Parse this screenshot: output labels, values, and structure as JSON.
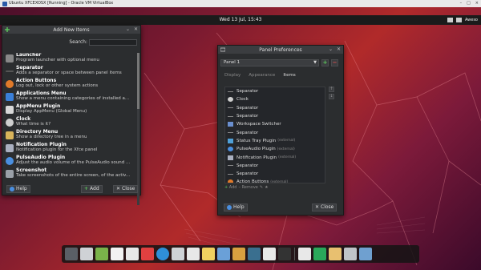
{
  "vbox": {
    "title": "Ubuntu XFCEXOSX [Running] - Oracle VM VirtualBox",
    "controls": [
      "–",
      "□",
      "×"
    ]
  },
  "panel": {
    "clock": "Wed 13 Jul, 15:43",
    "user": "Aweso"
  },
  "add_items": {
    "title": "Add New Items",
    "search_label": "Search:",
    "search_value": "",
    "items": [
      {
        "name": "Launcher",
        "desc": "Program launcher with optional menu",
        "icon": "launcher-icon"
      },
      {
        "name": "Separator",
        "desc": "Adds a separator or space between panel items",
        "icon": "separator-icon"
      },
      {
        "name": "Action Buttons",
        "desc": "Log out, lock or other system actions",
        "icon": "action-buttons-icon"
      },
      {
        "name": "Applications Menu",
        "desc": "Show a menu containing categories of installed a...",
        "icon": "applications-menu-icon"
      },
      {
        "name": "AppMenu Plugin",
        "desc": "Display AppMenu (Global Menu)",
        "icon": "appmenu-icon"
      },
      {
        "name": "Clock",
        "desc": "What time is it?",
        "icon": "clock-icon"
      },
      {
        "name": "Directory Menu",
        "desc": "Show a directory tree in a menu",
        "icon": "folder-icon"
      },
      {
        "name": "Notification Plugin",
        "desc": "Notification plugin for the Xfce panel",
        "icon": "notification-icon"
      },
      {
        "name": "PulseAudio Plugin",
        "desc": "Adjust the audio volume of the PulseAudio sound ...",
        "icon": "pulseaudio-icon"
      },
      {
        "name": "Screenshot",
        "desc": "Take screenshots of the entire screen, of the activ...",
        "icon": "screenshot-icon"
      }
    ],
    "help_label": "Help",
    "add_label": "Add",
    "close_label": "Close"
  },
  "prefs": {
    "title": "Panel Preferences",
    "panel_select": "Panel 1",
    "tabs": [
      "Display",
      "Appearance",
      "Items"
    ],
    "active_tab": "Items",
    "items": [
      {
        "name": "Separator",
        "ext": "",
        "icon": "separator-icon"
      },
      {
        "name": "Clock",
        "ext": "",
        "icon": "clock-icon"
      },
      {
        "name": "Separator",
        "ext": "",
        "icon": "separator-icon"
      },
      {
        "name": "Separator",
        "ext": "",
        "icon": "separator-icon"
      },
      {
        "name": "Workspace Switcher",
        "ext": "",
        "icon": "workspace-icon"
      },
      {
        "name": "Separator",
        "ext": "",
        "icon": "separator-icon"
      },
      {
        "name": "Status Tray Plugin",
        "ext": "(external)",
        "icon": "status-tray-icon"
      },
      {
        "name": "PulseAudio Plugin",
        "ext": "(external)",
        "icon": "pulseaudio-icon"
      },
      {
        "name": "Notification Plugin",
        "ext": "(external)",
        "icon": "notification-icon"
      },
      {
        "name": "Separator",
        "ext": "",
        "icon": "separator-icon"
      },
      {
        "name": "Separator",
        "ext": "",
        "icon": "separator-icon"
      },
      {
        "name": "Action Buttons",
        "ext": "(external)",
        "icon": "action-buttons-icon"
      }
    ],
    "add_label": "Add",
    "remove_label": "Remove",
    "help_label": "Help",
    "close_label": "Close"
  },
  "dock": {
    "icons": [
      "finder-icon",
      "settings-icon",
      "terminal-icon",
      "files-icon",
      "inkscape-icon",
      "pdf-icon",
      "globe-icon",
      "editor-icon",
      "document-icon",
      "notes-icon",
      "wifi-icon",
      "calendar-icon",
      "monitor-icon",
      "folder-icon",
      "terminal2-icon",
      "screenshot-icon",
      "add-icon",
      "home-folder-icon",
      "trash-icon",
      "desktop-icon"
    ]
  }
}
